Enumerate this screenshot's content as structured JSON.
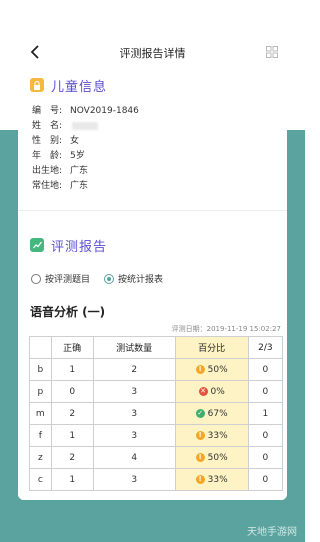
{
  "header": {
    "title": "评测报告详情"
  },
  "child_info": {
    "section_title": "儿童信息",
    "rows": [
      {
        "label": "编　号:",
        "value": "NOV2019-1846"
      },
      {
        "label": "姓　名:",
        "value": ""
      },
      {
        "label": "性　别:",
        "value": "女"
      },
      {
        "label": "年　龄:",
        "value": "5岁"
      },
      {
        "label": "出生地:",
        "value": "广东"
      },
      {
        "label": "常住地:",
        "value": "广东"
      }
    ]
  },
  "report": {
    "section_title": "评测报告",
    "options": [
      {
        "label": "按评测题目",
        "selected": false
      },
      {
        "label": "按统计报表",
        "selected": true
      }
    ],
    "analysis_title": "语音分析 (一)",
    "date_text": "评测日期：2019-11-19 15:02:27",
    "table": {
      "headers": [
        "",
        "正确",
        "测试数量",
        "百分比",
        "2/3"
      ],
      "rows": [
        {
          "sound": "b",
          "correct": "1",
          "count": "2",
          "status": "warn",
          "percent": "50%",
          "ratio": "0"
        },
        {
          "sound": "p",
          "correct": "0",
          "count": "3",
          "status": "err",
          "percent": "0%",
          "ratio": "0"
        },
        {
          "sound": "m",
          "correct": "2",
          "count": "3",
          "status": "ok",
          "percent": "67%",
          "ratio": "1"
        },
        {
          "sound": "f",
          "correct": "1",
          "count": "3",
          "status": "warn",
          "percent": "33%",
          "ratio": "0"
        },
        {
          "sound": "z",
          "correct": "2",
          "count": "4",
          "status": "warn",
          "percent": "50%",
          "ratio": "0"
        },
        {
          "sound": "c",
          "correct": "1",
          "count": "3",
          "status": "warn",
          "percent": "33%",
          "ratio": "0"
        }
      ]
    }
  },
  "watermark": "天地手游网",
  "colors": {
    "accent": "#5aa39f",
    "title_purple": "#5b4fd3",
    "warn": "#f5a623",
    "error": "#e2533f",
    "ok": "#3fae6d"
  }
}
